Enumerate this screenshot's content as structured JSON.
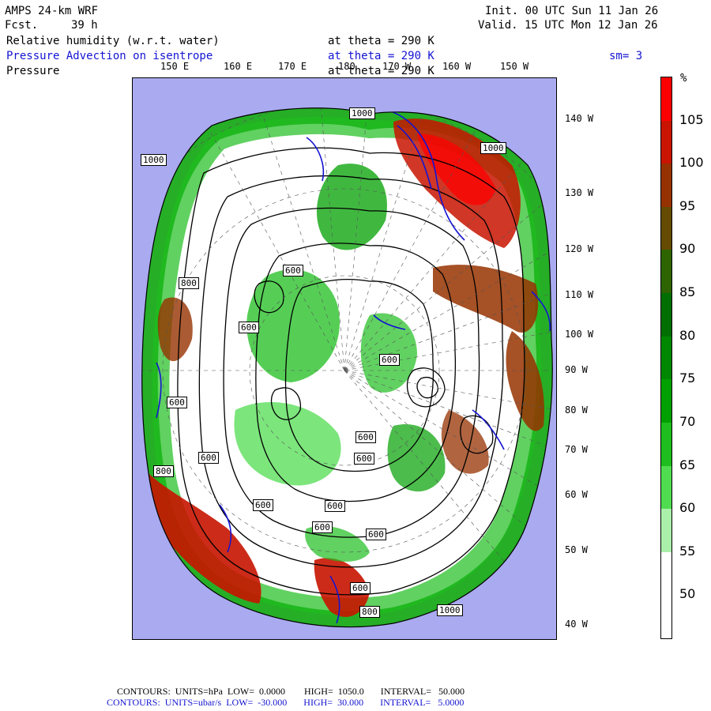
{
  "header": {
    "model": "AMPS 24-km WRF",
    "forecast_label": "Fcst.",
    "forecast_value": "39 h",
    "init": "Init. 00 UTC Sun 11 Jan 26",
    "valid": "Valid. 15 UTC Mon 12 Jan 26"
  },
  "fields": [
    {
      "name": "Relative humidity (w.r.t. water)",
      "level": "at theta = 290 K",
      "color": "#000000"
    },
    {
      "name": "Pressure Advection on isentrope",
      "level": "at theta = 290 K",
      "color": "#1414d2"
    },
    {
      "name": "Pressure",
      "level": "at theta = 290 K",
      "color": "#000000"
    }
  ],
  "smoothing": "sm= 3",
  "longitude_labels_top": [
    "150 E",
    "160 E",
    "170 E",
    "180",
    "170 W",
    "160 W",
    "150 W"
  ],
  "longitude_labels_right": [
    "140 W",
    "130 W",
    "120 W",
    "110 W",
    "100 W",
    "90 W",
    "80 W",
    "70 W",
    "60 W",
    "50 W",
    "40 W"
  ],
  "colorbar": {
    "unit": "%",
    "labels": [
      "105",
      "100",
      "95",
      "90",
      "85",
      "80",
      "75",
      "70",
      "65",
      "60",
      "55",
      "50"
    ],
    "colors": [
      "#ff0000",
      "#c81400",
      "#963200",
      "#644b00",
      "#2d6400",
      "#006e00",
      "#008700",
      "#00a000",
      "#1ebe1e",
      "#50dc50",
      "#aaf0aa",
      "#ffffff",
      "#ffffff"
    ]
  },
  "contour_labels": [
    "1000",
    "1000",
    "1000",
    "800",
    "600",
    "600",
    "600",
    "600",
    "800",
    "600",
    "600",
    "600",
    "600",
    "600",
    "600",
    "600",
    "600",
    "800",
    "1000"
  ],
  "footer": {
    "line1": "CONTOURS:  UNITS=hPa  LOW=  0.0000        HIGH=  1050.0       INTERVAL=   50.000",
    "line2": "CONTOURS:  UNITS=ubar/s  LOW=  -30.000       HIGH=  30.000       INTERVAL=   5.0000"
  },
  "colors": {
    "ocean": "#aaaaf0",
    "blue_contour": "#1414d2",
    "black_contour": "#000000"
  }
}
